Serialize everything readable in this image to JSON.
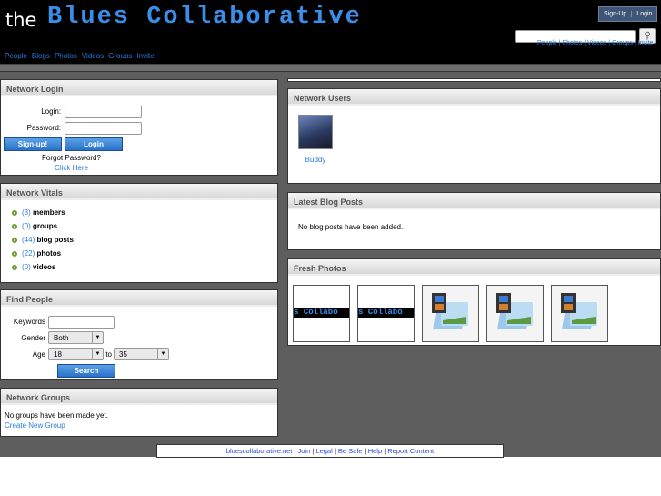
{
  "header": {
    "logo_prefix": "the",
    "logo_title": "Blues Collaborative",
    "nav": [
      "People",
      "Blogs",
      "Photos",
      "Videos",
      "Groups",
      "Invite"
    ],
    "auth": [
      "Sign-Up",
      "Login"
    ],
    "search_nav": [
      "People",
      "Photos",
      "Videos",
      "Groups",
      "Invite"
    ]
  },
  "login": {
    "title": "Network Login",
    "login_label": "Login:",
    "password_label": "Password:",
    "signup": "Sign-up!",
    "login_btn": "Login",
    "forgot": "Forgot Password?",
    "click_here": "Click Here"
  },
  "vitals": {
    "title": "Network Vitals",
    "items": [
      {
        "count": "(3)",
        "label": "members"
      },
      {
        "count": "(0)",
        "label": "groups"
      },
      {
        "count": "(44)",
        "label": "blog posts"
      },
      {
        "count": "(22)",
        "label": "photos"
      },
      {
        "count": "(0)",
        "label": "videos"
      }
    ]
  },
  "find": {
    "title": "Find People",
    "keywords": "Keywords",
    "gender": "Gender",
    "gender_value": "Both",
    "age": "Age",
    "age_from": "18",
    "to": "to",
    "age_to": "35",
    "search": "Search"
  },
  "groups": {
    "title": "Network Groups",
    "empty": "No groups have been made yet.",
    "create": "Create New Group"
  },
  "users": {
    "title": "Network Users",
    "items": [
      {
        "name": "Buddy"
      }
    ]
  },
  "blog": {
    "title": "Latest Blog Posts",
    "empty": "No blog posts have been added."
  },
  "photos": {
    "title": "Fresh Photos",
    "strip_text": "s Collabo"
  },
  "footer": {
    "links": [
      "bluescollaborative.net",
      "Join",
      "Legal",
      "Be Safe",
      "Help",
      "Report Content"
    ]
  }
}
